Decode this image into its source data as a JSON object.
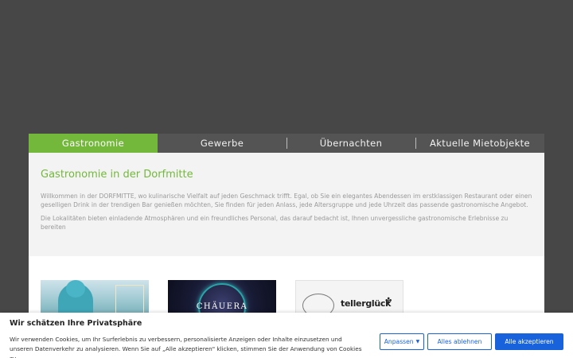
{
  "tabs": [
    {
      "label": "Gastronomie",
      "active": true
    },
    {
      "label": "Gewerbe",
      "active": false
    },
    {
      "label": "Übernachten",
      "active": false
    },
    {
      "label": "Aktuelle Mietobjekte",
      "active": false
    }
  ],
  "content": {
    "heading": "Gastronomie in der Dorfmitte",
    "paragraph1": "Willkommen in der DORFMITTE, wo kulinarische Vielfalt auf jeden Geschmack trifft. Egal, ob Sie ein elegantes Abendessen im erstklassigen Restaurant oder einen geselligen Drink in der trendigen Bar genießen möchten, Sie finden für jeden Anlass, jede Altersgruppe und jede Uhrzeit das passende gastronomische Angebot.",
    "paragraph2": "Die Lokalitäten bieten einladende Atmosphären und ein freundliches Personal, das darauf bedacht ist, Ihnen unvergessliche gastronomische Erlebnisse zu bereiten"
  },
  "cards": {
    "card2_logo": "CHÄUERA",
    "card3_brand": "tellerglück",
    "card3_clover": "✤"
  },
  "cookie": {
    "title": "Wir schätzen Ihre Privatsphäre",
    "text": "Wir verwenden Cookies, um Ihr Surferlebnis zu verbessern, personalisierte Anzeigen oder Inhalte einzusetzen und unseren Datenverkehr zu analysieren. Wenn Sie auf „Alle akzeptieren\" klicken, stimmen Sie der Anwendung von Cookies zu.",
    "customize_label": "Anpassen",
    "reject_label": "Alles ablehnen",
    "accept_label": "Alle akzeptieren"
  },
  "colors": {
    "accent": "#73b83a",
    "cookie_button": "#1863dc"
  }
}
